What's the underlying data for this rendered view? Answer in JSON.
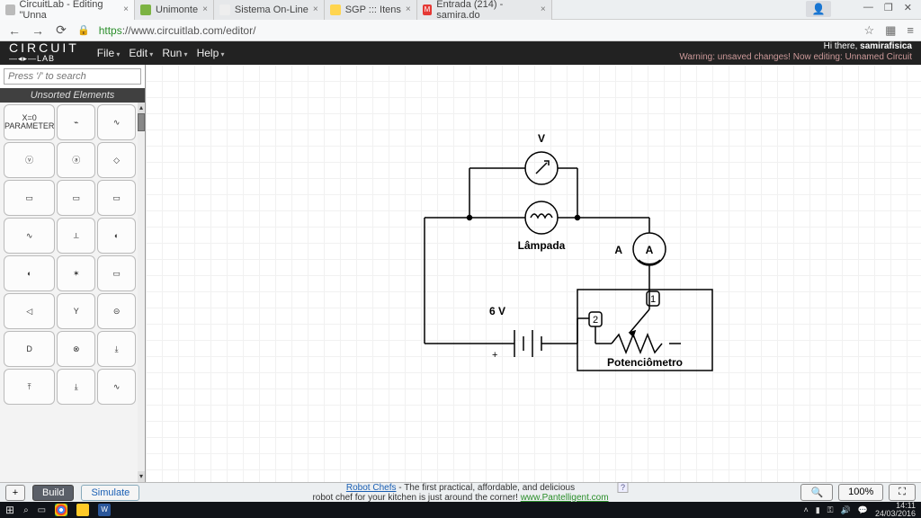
{
  "tabs": [
    {
      "title": "CircuitLab - Editing \"Unna",
      "active": true
    },
    {
      "title": "Unimonte"
    },
    {
      "title": "Sistema On-Line"
    },
    {
      "title": "SGP ::: Itens"
    },
    {
      "title": "Entrada (214) - samira.do"
    }
  ],
  "window": {
    "minimize": "—",
    "maximize": "❐",
    "close": "✕"
  },
  "address": {
    "back": "←",
    "forward": "→",
    "reload": "⟳",
    "lock": "🔒",
    "proto": "https",
    "host": "://www.circuitlab.com",
    "path": "/editor/",
    "star": "☆",
    "user": "👤",
    "menu": "≡"
  },
  "brand": {
    "line1": "CIRCUIT",
    "line2": "—◂▸—LAB"
  },
  "menu": {
    "file": "File",
    "edit": "Edit",
    "run": "Run",
    "help": "Help"
  },
  "status": {
    "greeting": "Hi there, ",
    "user": "samirafisica",
    "warn": "Warning: unsaved changes! Now editing: Unnamed Circuit"
  },
  "sidebar": {
    "search_placeholder": "Press '/' to search",
    "close": "×",
    "section": "Unsorted Elements",
    "cells": [
      "X=0\nPARAMETER",
      "⌁",
      "∿",
      "ⓥ",
      "ⓐ",
      "◇",
      "▭",
      "▭",
      "▭",
      "∿",
      "⟂",
      "◐",
      "◐",
      "✶",
      "▭",
      "◁",
      "Y",
      "⊝",
      "D",
      "⊗",
      "⤓",
      "⤒",
      "⤓",
      "∿"
    ]
  },
  "circuit": {
    "v_label": "V",
    "a_label": "A",
    "lamp": "Lâmpada",
    "volt": "6 V",
    "pot": "Potenciômetro",
    "t1": "1",
    "t2": "2",
    "plus": "+"
  },
  "bottom": {
    "plus": "+",
    "build": "Build",
    "simulate": "Simulate",
    "ad_b": "Robot Chefs",
    "ad_mid": " - The first practical, affordable, and delicious",
    "ad_line2": "robot chef for your kitchen is just around the corner!   ",
    "ad_link": "www.Pantelligent.com",
    "ad_q": "?",
    "zoom_in": "🔍",
    "zoom_val": "100%",
    "zoom_fit": "⛶"
  },
  "taskbar": {
    "time": "14:11",
    "date": "24/03/2016"
  }
}
